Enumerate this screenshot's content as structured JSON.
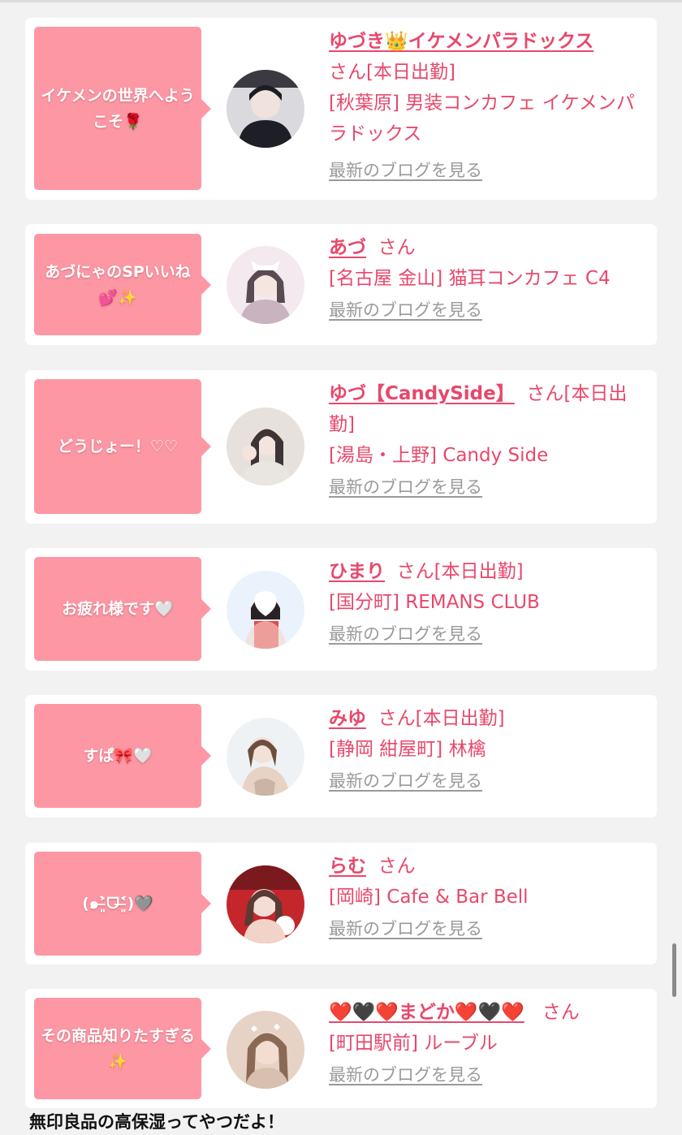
{
  "cards": [
    {
      "bubble": "イケメンの世界へようこそ🌹",
      "name": "ゆづき👑イケメンパラドックス",
      "suffix": "さん[本日出勤]",
      "shop": "[秋葉原] 男装コンカフェ イケメンパラドックス",
      "blog": "最新のブログを見る",
      "avatar_icon": "person-photo-avatar",
      "avatar_colors": [
        "#2a2a30",
        "#d9d9de"
      ]
    },
    {
      "bubble": "あづにゃのSPいいね💕✨",
      "name": "あづ",
      "suffix": "さん",
      "shop": "[名古屋 金山] 猫耳コンカフェ C4",
      "blog": "最新のブログを見る",
      "avatar_icon": "person-photo-avatar",
      "avatar_colors": [
        "#f3e9ee",
        "#c9b3bf"
      ]
    },
    {
      "bubble": "どうじょー！♡♡",
      "name": "ゆづ【CandySide】",
      "suffix": "さん[本日出勤]",
      "shop": "[湯島・上野] Candy Side",
      "blog": "最新のブログを見る",
      "avatar_icon": "person-photo-avatar",
      "avatar_colors": [
        "#e6e1dc",
        "#3d3535"
      ]
    },
    {
      "bubble": "お疲れ様です🤍",
      "name": "ひまり",
      "suffix": "さん[本日出勤]",
      "shop": "[国分町] REMANS CLUB",
      "blog": "最新のブログを見る",
      "avatar_icon": "person-photo-avatar",
      "avatar_colors": [
        "#eaf3fb",
        "#e5484d"
      ]
    },
    {
      "bubble": "すぱ🎀🤍",
      "name": "みゆ",
      "suffix": "さん[本日出勤]",
      "shop": "[静岡 紺屋町] 林檎",
      "blog": "最新のブログを見る",
      "avatar_icon": "person-photo-avatar",
      "avatar_colors": [
        "#eef2f5",
        "#d8c2b2"
      ]
    },
    {
      "bubble": "(๑˃̶͈̀ᗜ˂̶͈́)🩶",
      "name": "らむ",
      "suffix": "さん",
      "shop": "[岡崎] Cafe & Bar Bell",
      "blog": "最新のブログを見る",
      "avatar_icon": "person-photo-avatar",
      "avatar_colors": [
        "#c4262c",
        "#f2d3c8"
      ]
    },
    {
      "bubble": "その商品知りたすぎる✨",
      "name": "❤️🖤❤️まどか❤️🖤❤️",
      "suffix": "さん",
      "shop": "[町田駅前] ルーブル",
      "blog": "最新のブログを見る",
      "avatar_icon": "person-photo-avatar",
      "avatar_colors": [
        "#e7d3c6",
        "#8a6a55"
      ]
    }
  ],
  "footer_text": "無印良品の高保湿ってやつだよ！"
}
